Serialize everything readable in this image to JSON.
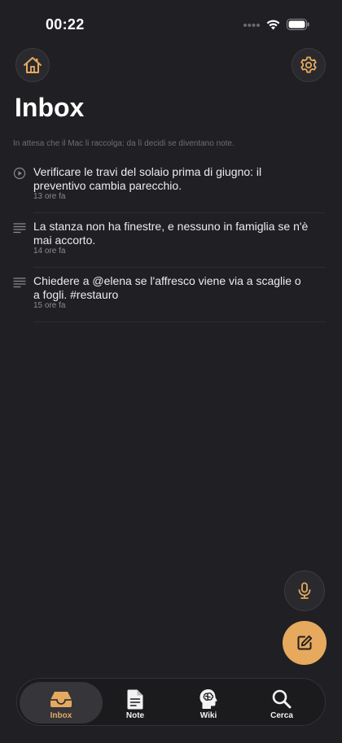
{
  "status_bar": {
    "time": "00:22"
  },
  "header": {
    "title": "Inbox",
    "subtitle": "In attesa che il Mac li raccolga: da lì decidi se diventano note."
  },
  "items": [
    {
      "icon": "play-circle-icon",
      "text": "Verificare le travi del solaio prima di giugno: il preventivo cambia parecchio.",
      "time": "13 ore fa"
    },
    {
      "icon": "text-lines-icon",
      "text": "La stanza non ha finestre, e nessuno in famiglia se n'è mai accorto.",
      "time": "14 ore fa"
    },
    {
      "icon": "text-lines-icon",
      "text": "Chiedere a @elena se l'affresco viene via a scaglie o a fogli. #restauro",
      "time": "15 ore fa"
    }
  ],
  "tabs": [
    {
      "label": "Inbox",
      "icon": "tray-icon",
      "active": true
    },
    {
      "label": "Note",
      "icon": "document-icon",
      "active": false
    },
    {
      "label": "Wiki",
      "icon": "brain-head-icon",
      "active": false
    },
    {
      "label": "Cerca",
      "icon": "search-icon",
      "active": false
    }
  ],
  "colors": {
    "background": "#202024",
    "accent": "#e7a95e",
    "text": "#ececec",
    "muted": "#8a8a8f"
  }
}
